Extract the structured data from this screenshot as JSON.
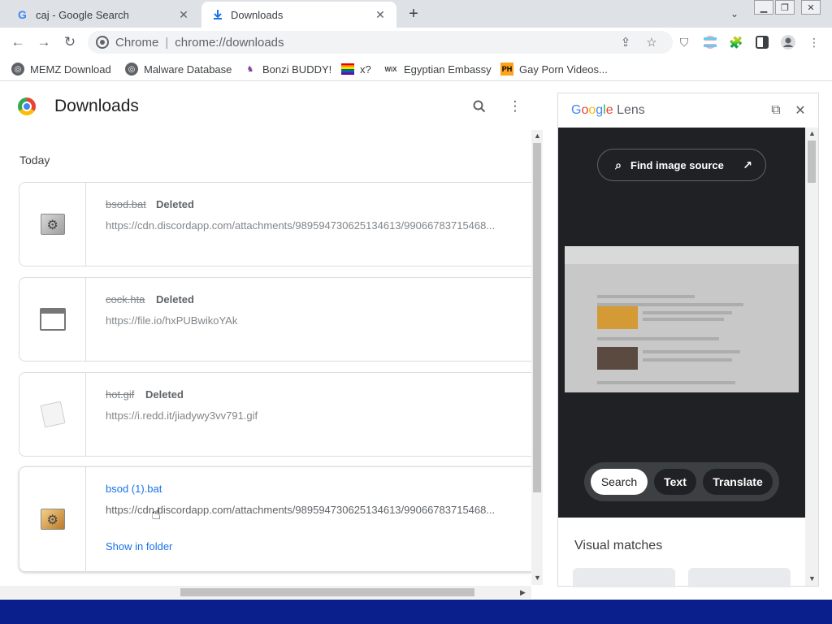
{
  "tabs": [
    {
      "title": "caj - Google Search",
      "favicon": "google-g-icon"
    },
    {
      "title": "Downloads",
      "favicon": "download-icon"
    }
  ],
  "address": {
    "scheme": "Chrome",
    "url": "chrome://downloads"
  },
  "bookmarks": [
    {
      "label": "MEMZ Download",
      "icon": "globe-icon"
    },
    {
      "label": "Malware Database",
      "icon": "globe-icon"
    },
    {
      "label": "Bonzi BUDDY!",
      "icon": "bonzi-icon"
    },
    {
      "label": "x?",
      "icon": "rainbow-flag-icon"
    },
    {
      "label": "Egyptian Embassy",
      "icon": "wix-icon",
      "icon_text": "WiX"
    },
    {
      "label": "Gay Porn Videos...",
      "icon": "ph-icon",
      "icon_text": "PH"
    }
  ],
  "page": {
    "title": "Downloads",
    "section": "Today"
  },
  "downloads": [
    {
      "name": "bsod.bat",
      "status": "Deleted",
      "url": "https://cdn.discordapp.com/attachments/989594730625134613/99066783715468...",
      "icon": "bat-file-icon"
    },
    {
      "name": "cock.hta",
      "status": "Deleted",
      "url": "https://file.io/hxPUBwikoYAk",
      "icon": "window-file-icon"
    },
    {
      "name": "hot.gif",
      "status": "Deleted",
      "url": "https://i.redd.it/jiadywy3vv791.gif",
      "icon": "gif-file-icon"
    },
    {
      "name": "bsod (1).bat",
      "status": "",
      "url": "https://cdn.discordapp.com/attachments/989594730625134613/99066783715468...",
      "action": "Show in folder",
      "icon": "bat-file-icon"
    }
  ],
  "lens": {
    "title_rest": "Lens",
    "find_source": "Find image source",
    "tabs": [
      "Search",
      "Text",
      "Translate"
    ],
    "selected_tab": "Search",
    "visual_matches": "Visual matches"
  },
  "colors": {
    "accent": "#1a73e8",
    "taskbar": "#0a1e8c",
    "lens_dark": "#202124"
  }
}
